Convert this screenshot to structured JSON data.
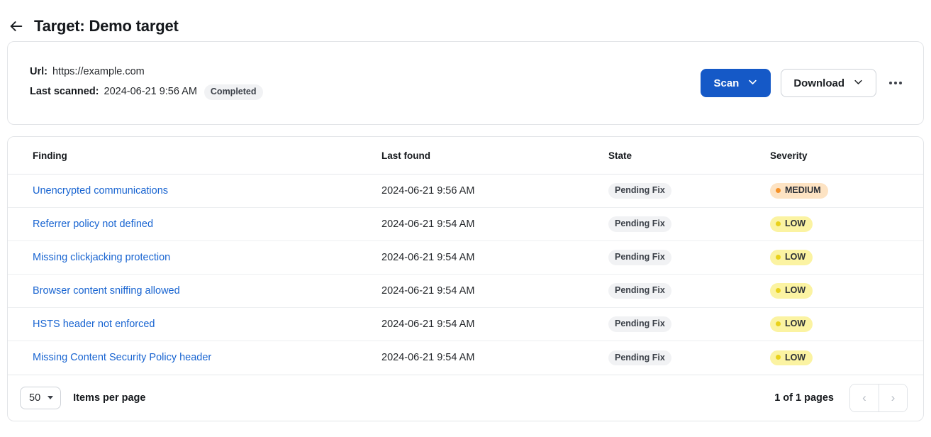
{
  "header": {
    "back_icon": "arrow-left-icon",
    "title": "Target: Demo target"
  },
  "summary": {
    "url_label": "Url:",
    "url_value": "https://example.com",
    "last_scanned_label": "Last scanned:",
    "last_scanned_value": "2024-06-21 9:56 AM",
    "status_chip": "Completed",
    "scan_button": "Scan",
    "download_button": "Download",
    "more_icon": "ellipsis-icon",
    "chevron_icon": "chevron-down-icon"
  },
  "table": {
    "columns": [
      "Finding",
      "Last found",
      "State",
      "Severity"
    ],
    "rows": [
      {
        "finding": "Unencrypted communications",
        "last_found": "2024-06-21 9:56 AM",
        "state": "Pending Fix",
        "severity": "MEDIUM"
      },
      {
        "finding": "Referrer policy not defined",
        "last_found": "2024-06-21 9:54 AM",
        "state": "Pending Fix",
        "severity": "LOW"
      },
      {
        "finding": "Missing clickjacking protection",
        "last_found": "2024-06-21 9:54 AM",
        "state": "Pending Fix",
        "severity": "LOW"
      },
      {
        "finding": "Browser content sniffing allowed",
        "last_found": "2024-06-21 9:54 AM",
        "state": "Pending Fix",
        "severity": "LOW"
      },
      {
        "finding": "HSTS header not enforced",
        "last_found": "2024-06-21 9:54 AM",
        "state": "Pending Fix",
        "severity": "LOW"
      },
      {
        "finding": "Missing Content Security Policy header",
        "last_found": "2024-06-21 9:54 AM",
        "state": "Pending Fix",
        "severity": "LOW"
      }
    ]
  },
  "footer": {
    "items_per_page_value": "50",
    "items_per_page_label": "Items per page",
    "page_status": "1 of 1 pages",
    "prev_icon": "chevron-left-icon",
    "next_icon": "chevron-right-icon",
    "prev_glyph": "‹",
    "next_glyph": "›"
  },
  "colors": {
    "primary": "#1559c7",
    "link": "#1864d1",
    "severity_medium_bg": "#fde3c3",
    "severity_medium_dot": "#f59128",
    "severity_low_bg": "#fbf3a2",
    "severity_low_dot": "#e9d11b",
    "chip_bg": "#f1f2f4"
  }
}
